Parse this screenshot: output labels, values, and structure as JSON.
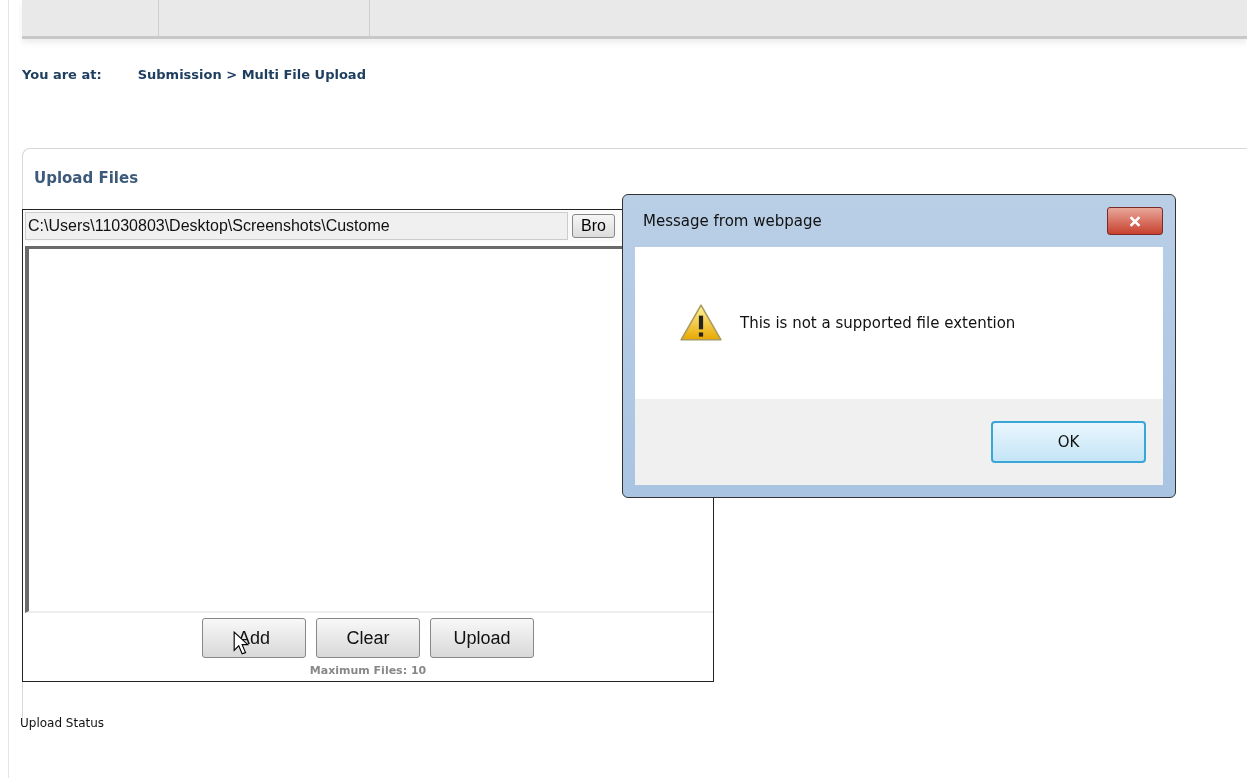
{
  "breadcrumb": {
    "label": "You are at:",
    "path": "Submission > Multi File Upload"
  },
  "panel": {
    "title": "Upload Files",
    "uploader": {
      "file_path": "C:\\Users\\11030803\\Desktop\\Screenshots\\Custome",
      "browse_button": "Bro",
      "buttons": [
        "Add",
        "Clear",
        "Upload"
      ],
      "max_files_note": "Maximum Files: 10"
    },
    "status_label": "Upload Status"
  },
  "dialog": {
    "title": "Message from webpage",
    "message": "This is not a supported file extention",
    "button": "OK"
  }
}
